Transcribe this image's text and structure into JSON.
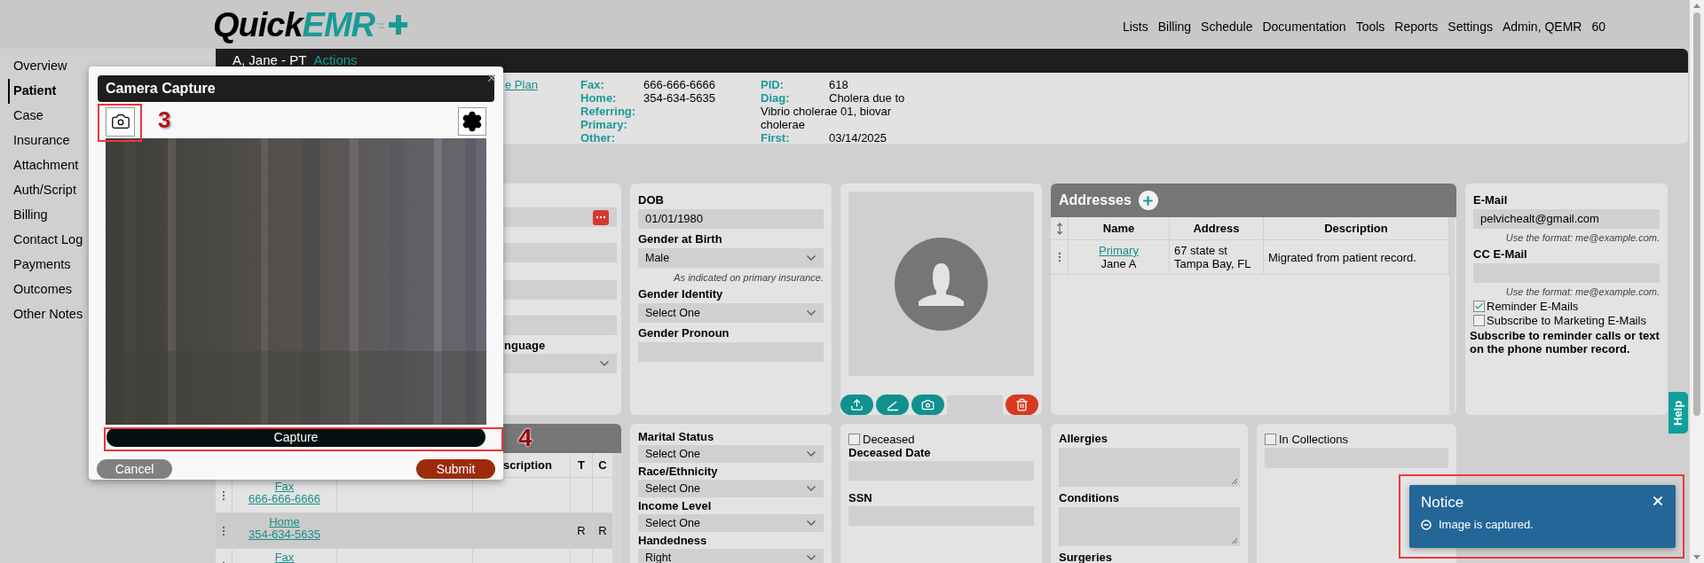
{
  "header": {
    "logo": {
      "word": "Quick",
      "accent": "EMR"
    },
    "nav": [
      "Lists",
      "Billing",
      "Schedule",
      "Documentation",
      "Tools",
      "Reports",
      "Settings",
      "Admin, QEMR",
      "60"
    ]
  },
  "sidebar": {
    "items": [
      {
        "label": "Overview",
        "selected": false
      },
      {
        "label": "Patient",
        "selected": true
      },
      {
        "label": "Case",
        "selected": false
      },
      {
        "label": "Insurance",
        "selected": false
      },
      {
        "label": "Attachment",
        "selected": false
      },
      {
        "label": "Auth/Script",
        "selected": false
      },
      {
        "label": "Billing",
        "selected": false
      },
      {
        "label": "Contact Log",
        "selected": false
      },
      {
        "label": "Payments",
        "selected": false
      },
      {
        "label": "Outcomes",
        "selected": false
      },
      {
        "label": "Other Notes",
        "selected": false
      }
    ]
  },
  "patient_bar": {
    "name": "A, Jane - PT",
    "actions": "Actions"
  },
  "info": {
    "link": "e Plan",
    "contacts": [
      {
        "label": "Fax:",
        "value": "666-666-6666"
      },
      {
        "label": "Home:",
        "value": "354-634-5635"
      },
      {
        "label": "Referring:"
      },
      {
        "label": "Primary:"
      },
      {
        "label": "Other:"
      }
    ],
    "case": [
      {
        "label": "PID:",
        "value": "618"
      },
      {
        "label": "Diag:",
        "value": "Cholera due to Vibrio cholerae 01, biovar cholerae"
      },
      {
        "label": "First:",
        "value": "03/14/2025"
      }
    ]
  },
  "partial_card": {
    "label": "nguage"
  },
  "demographics": [
    {
      "kind": "text",
      "label": "DOB",
      "value": "01/01/1980"
    },
    {
      "kind": "select",
      "label": "Gender at Birth",
      "value": "Male",
      "hint": "As indicated on primary insurance."
    },
    {
      "kind": "select",
      "label": "Gender Identity",
      "value": "Select One"
    },
    {
      "kind": "text",
      "label": "Gender Pronoun"
    }
  ],
  "photo": {
    "buttons": [
      {
        "kind": "upload"
      },
      {
        "kind": "sign"
      },
      {
        "kind": "camera"
      },
      {
        "kind": "field"
      },
      {
        "kind": "delete"
      }
    ]
  },
  "addresses": {
    "title": "Addresses",
    "columns": [
      "Name",
      "Address",
      "Description"
    ],
    "rows": [
      {
        "name": "Primary",
        "person": "Jane A",
        "address": [
          "67 state st",
          "Tampa Bay, FL"
        ],
        "description": "Migrated from patient record."
      }
    ]
  },
  "email": {
    "label": "E-Mail",
    "value": "pelvichealt@gmail.com",
    "hint": "Use the format: me@example.com.",
    "cc_label": "CC E-Mail",
    "cc_hint": "Use the format: me@example.com.",
    "options": [
      {
        "label": "Reminder E-Mails",
        "checked": true
      },
      {
        "label": "Subscribe to Marketing E-Mails",
        "checked": false
      }
    ],
    "note": "Subscribe to reminder calls or text on the phone number record."
  },
  "phones": {
    "columns": [
      "scription",
      "T",
      "C"
    ],
    "rows": [
      {
        "type": "Fax",
        "number": "666-666-6666"
      },
      {
        "type": "Home",
        "number": "354-634-5635",
        "t": "R",
        "c": "R"
      },
      {
        "type": "Fax"
      }
    ]
  },
  "details": [
    {
      "label": "Marital Status",
      "value": "Select One"
    },
    {
      "label": "Race/Ethnicity",
      "value": "Select One"
    },
    {
      "label": "Income Level",
      "value": "Select One"
    },
    {
      "label": "Handedness",
      "value": "Right"
    }
  ],
  "deceased": {
    "label": "Deceased",
    "checked": false,
    "fields": [
      "Deceased Date",
      "SSN"
    ]
  },
  "medical": [
    "Allergies",
    "Conditions",
    "Surgeries"
  ],
  "collections": {
    "label": "In Collections",
    "checked": false
  },
  "modal": {
    "title": "Camera Capture",
    "capture": "Capture",
    "cancel": "Cancel",
    "submit": "Submit"
  },
  "notice": {
    "title": "Notice",
    "message": "Image is captured."
  },
  "help": "Help",
  "annotations": [
    "3",
    "4"
  ]
}
